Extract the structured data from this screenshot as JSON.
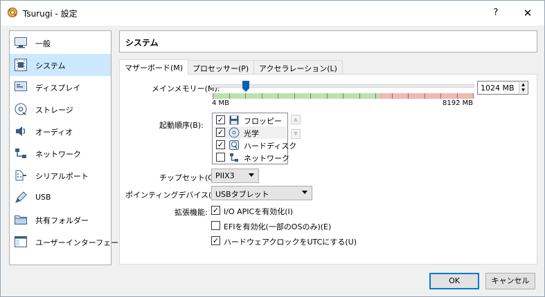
{
  "window": {
    "title": "Tsurugi - 設定",
    "help_glyph": "?",
    "close_glyph": "✕",
    "app_icon": "gear-icon"
  },
  "sidebar": {
    "items": [
      {
        "label": "一般",
        "icon": "monitor-icon",
        "selected": false
      },
      {
        "label": "システム",
        "icon": "chip-icon",
        "selected": true
      },
      {
        "label": "ディスプレイ",
        "icon": "display-icon",
        "selected": false
      },
      {
        "label": "ストレージ",
        "icon": "disk-icon",
        "selected": false
      },
      {
        "label": "オーディオ",
        "icon": "speaker-icon",
        "selected": false
      },
      {
        "label": "ネットワーク",
        "icon": "network-icon",
        "selected": false
      },
      {
        "label": "シリアルポート",
        "icon": "serial-port-icon",
        "selected": false
      },
      {
        "label": "USB",
        "icon": "usb-icon",
        "selected": false
      },
      {
        "label": "共有フォルダー",
        "icon": "folder-icon",
        "selected": false
      },
      {
        "label": "ユーザーインターフェース",
        "icon": "ui-window-icon",
        "selected": false
      }
    ]
  },
  "header": {
    "title": "システム"
  },
  "tabs": [
    {
      "label": "マザーボード(M)",
      "active": true
    },
    {
      "label": "プロセッサー(P)",
      "active": false
    },
    {
      "label": "アクセラレーション(L)",
      "active": false
    }
  ],
  "motherboard": {
    "memory_label": "メインメモリー(M):",
    "memory_value": "1024 MB",
    "memory_min_label": "4 MB",
    "memory_max_label": "8192 MB",
    "memory_value_mb": 1024,
    "memory_max_mb": 8192,
    "memory_green_fraction": 0.64,
    "boot_order_label": "起動順序(B):",
    "boot_items": [
      {
        "label": "フロッピー",
        "checked": true,
        "icon": "floppy-icon"
      },
      {
        "label": "光学",
        "checked": true,
        "icon": "optical-disc-icon"
      },
      {
        "label": "ハードディスク",
        "checked": true,
        "icon": "hard-disk-icon"
      },
      {
        "label": "ネットワーク",
        "checked": false,
        "icon": "network-icon"
      }
    ],
    "move_up_glyph": "▲",
    "move_down_glyph": "▼",
    "chipset_label": "チップセット(C):",
    "chipset_value": "PIIX3",
    "pointing_label": "ポインティングデバイス(P):",
    "pointing_value": "USBタブレット",
    "extended_label": "拡張機能:",
    "features": [
      {
        "label": "I/O APICを有効化(I)",
        "checked": true
      },
      {
        "label": "EFIを有効化(一部のOSのみ)(E)",
        "checked": false
      },
      {
        "label": "ハードウェアクロックをUTCにする(U)",
        "checked": true
      }
    ],
    "check_glyph": "✓"
  },
  "buttons": {
    "ok": "OK",
    "cancel": "キャンセル"
  },
  "colors": {
    "selected_bg": "#cce8ff",
    "slider_thumb": "#0063b1",
    "scale_green": "#bce1ad",
    "scale_red": "#f2b8b3"
  }
}
